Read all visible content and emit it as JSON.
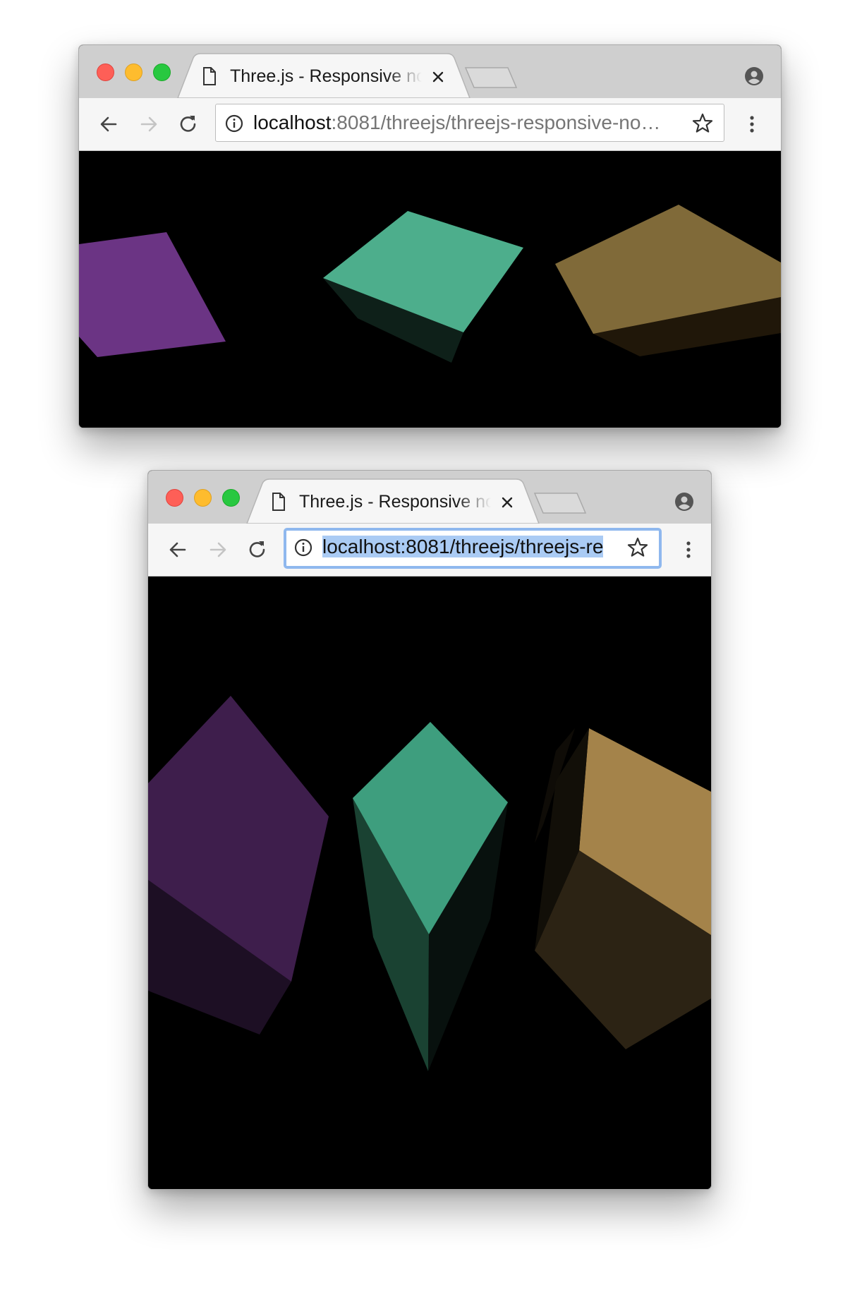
{
  "windows": [
    {
      "tab": {
        "title": "Three.js - Responsive no Resize"
      },
      "address_bar": {
        "host": "localhost",
        "path": ":8081/threejs/threejs-responsive-no…",
        "focused": false
      }
    },
    {
      "tab": {
        "title": "Three.js - Responsive no Resize"
      },
      "address_bar": {
        "full_url": "localhost:8081/threejs/threejs-re",
        "focused": true
      }
    }
  ],
  "icons": {
    "back": "arrow-left-icon",
    "forward": "arrow-right-icon",
    "reload": "reload-icon",
    "info": "info-circle-icon",
    "bookmark": "star-outline-icon",
    "menu": "vertical-dots-icon",
    "profile": "account-circle-icon",
    "page": "document-icon",
    "close": "close-x-icon"
  },
  "colors": {
    "cube_purple": "#6b3484",
    "cube_teal": "#4dae8c",
    "cube_gold": "#806a39",
    "canvas_background": "#000000",
    "selection": "#aacbf4",
    "focus_ring": "#8fb8ee"
  }
}
